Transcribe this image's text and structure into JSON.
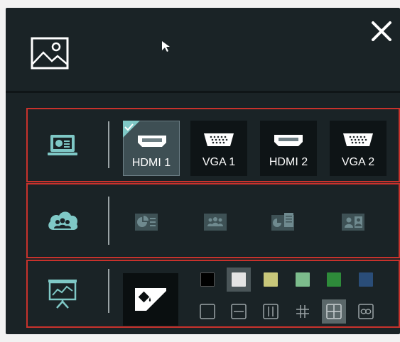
{
  "header": {
    "image_icon": "image-icon",
    "close_icon": "close-icon"
  },
  "sources": {
    "icon": "laptop-screen-icon",
    "items": [
      {
        "label": "HDMI 1",
        "port": "hdmi",
        "selected": true
      },
      {
        "label": "VGA 1",
        "port": "vga",
        "selected": false
      },
      {
        "label": "HDMI 2",
        "port": "hdmi",
        "selected": false
      },
      {
        "label": "VGA 2",
        "port": "vga",
        "selected": false
      }
    ]
  },
  "layouts": {
    "icon": "cloud-users-icon",
    "items": [
      "chart-text-layout-icon",
      "grouped-users-layout-icon",
      "chart-document-layout-icon",
      "person-card-layout-icon"
    ]
  },
  "background": {
    "icon": "presentation-board-icon",
    "tile_icon": "paint-bucket-icon",
    "colors": [
      "#000000",
      "#e4e4e4",
      "#c8c77a",
      "#7cbc8c",
      "#2e8b3a",
      "#2a4d78"
    ],
    "selected_color": 1,
    "patterns": [
      "blank",
      "horizontal-line",
      "vertical-lines",
      "grid",
      "cross",
      "infinity"
    ],
    "selected_pattern": 4
  },
  "colors": {
    "panel": "#1a2326",
    "row_border": "#c8322c",
    "accent": "#7fc8c6"
  }
}
